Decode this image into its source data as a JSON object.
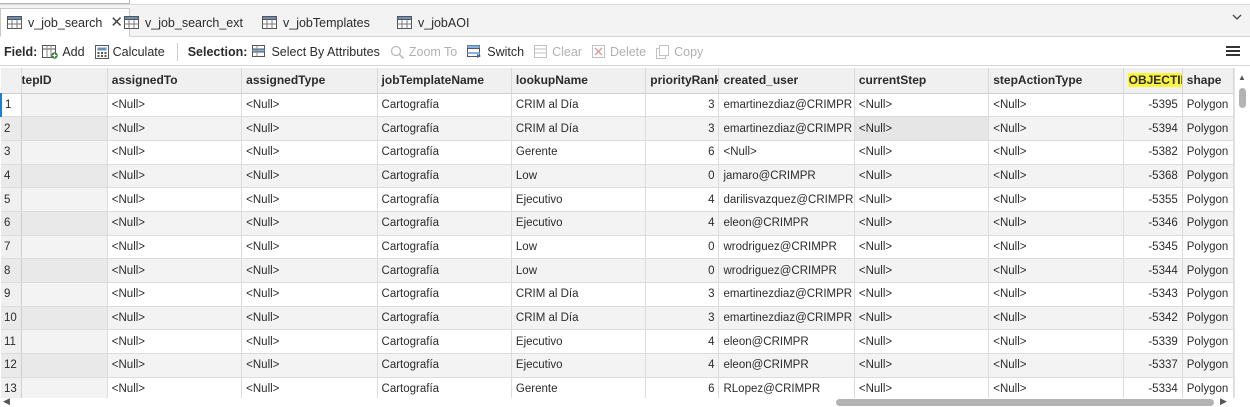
{
  "tabs": [
    {
      "label": "v_job_search",
      "active": true
    },
    {
      "label": "v_job_search_ext",
      "active": false
    },
    {
      "label": "v_jobTemplates",
      "active": false
    },
    {
      "label": "v_jobAOI",
      "active": false
    }
  ],
  "toolbar": {
    "field_label": "Field:",
    "add": "Add",
    "calculate": "Calculate",
    "selection_label": "Selection:",
    "select_by_attributes": "Select By Attributes",
    "zoom_to": "Zoom To",
    "switch": "Switch",
    "clear": "Clear",
    "delete": "Delete",
    "copy": "Copy"
  },
  "columns": [
    "tepID",
    "assignedTo",
    "assignedType",
    "jobTemplateName",
    "lookupName",
    "priorityRank",
    "created_user",
    "currentStep",
    "stepActionType",
    "OBJECTID",
    "shape"
  ],
  "rows": [
    {
      "n": "1",
      "cells": [
        "",
        "<Null>",
        "<Null>",
        "Cartografía",
        "CRIM al Día",
        "3",
        "emartinezdiaz@CRIMPR",
        "<Null>",
        "<Null>",
        "-5395",
        "Polygon"
      ]
    },
    {
      "n": "2",
      "cells": [
        "",
        "<Null>",
        "<Null>",
        "Cartografía",
        "CRIM al Día",
        "3",
        "emartinezdiaz@CRIMPR",
        "<Null>",
        "<Null>",
        "-5394",
        "Polygon"
      ]
    },
    {
      "n": "3",
      "cells": [
        "",
        "<Null>",
        "<Null>",
        "Cartografía",
        "Gerente",
        "6",
        "<Null>",
        "<Null>",
        "<Null>",
        "-5382",
        "Polygon"
      ]
    },
    {
      "n": "4",
      "cells": [
        "",
        "<Null>",
        "<Null>",
        "Cartografía",
        "Low",
        "0",
        "jamaro@CRIMPR",
        "<Null>",
        "<Null>",
        "-5368",
        "Polygon"
      ]
    },
    {
      "n": "5",
      "cells": [
        "",
        "<Null>",
        "<Null>",
        "Cartografía",
        "Ejecutivo",
        "4",
        "darilisvazquez@CRIMPR",
        "<Null>",
        "<Null>",
        "-5355",
        "Polygon"
      ]
    },
    {
      "n": "6",
      "cells": [
        "",
        "<Null>",
        "<Null>",
        "Cartografía",
        "Ejecutivo",
        "4",
        "eleon@CRIMPR",
        "<Null>",
        "<Null>",
        "-5346",
        "Polygon"
      ]
    },
    {
      "n": "7",
      "cells": [
        "",
        "<Null>",
        "<Null>",
        "Cartografía",
        "Low",
        "0",
        "wrodriguez@CRIMPR",
        "<Null>",
        "<Null>",
        "-5345",
        "Polygon"
      ]
    },
    {
      "n": "8",
      "cells": [
        "",
        "<Null>",
        "<Null>",
        "Cartografía",
        "Low",
        "0",
        "wrodriguez@CRIMPR",
        "<Null>",
        "<Null>",
        "-5344",
        "Polygon"
      ]
    },
    {
      "n": "9",
      "cells": [
        "",
        "<Null>",
        "<Null>",
        "Cartografía",
        "CRIM al Día",
        "3",
        "emartinezdiaz@CRIMPR",
        "<Null>",
        "<Null>",
        "-5343",
        "Polygon"
      ]
    },
    {
      "n": "10",
      "cells": [
        "",
        "<Null>",
        "<Null>",
        "Cartografía",
        "CRIM al Día",
        "3",
        "emartinezdiaz@CRIMPR",
        "<Null>",
        "<Null>",
        "-5342",
        "Polygon"
      ]
    },
    {
      "n": "11",
      "cells": [
        "",
        "<Null>",
        "<Null>",
        "Cartografía",
        "Ejecutivo",
        "4",
        "eleon@CRIMPR",
        "<Null>",
        "<Null>",
        "-5339",
        "Polygon"
      ]
    },
    {
      "n": "12",
      "cells": [
        "",
        "<Null>",
        "<Null>",
        "Cartografía",
        "Ejecutivo",
        "4",
        "eleon@CRIMPR",
        "<Null>",
        "<Null>",
        "-5337",
        "Polygon"
      ]
    },
    {
      "n": "13",
      "cells": [
        "",
        "<Null>",
        "<Null>",
        "Cartografía",
        "Gerente",
        "6",
        "RLopez@CRIMPR",
        "<Null>",
        "<Null>",
        "-5334",
        "Polygon"
      ]
    }
  ],
  "icons": {
    "tab": "table-icon",
    "add": "add-field-icon",
    "calculate": "calculator-icon",
    "select_by_attributes": "select-by-attributes-icon",
    "zoom_to": "zoom-to-icon",
    "switch": "switch-selection-icon",
    "clear": "clear-selection-icon",
    "delete": "delete-icon",
    "copy": "copy-icon",
    "menu": "hamburger-menu-icon"
  },
  "colors": {
    "highlight": "#fbf53b",
    "selection_accent": "#1a7fd6"
  }
}
